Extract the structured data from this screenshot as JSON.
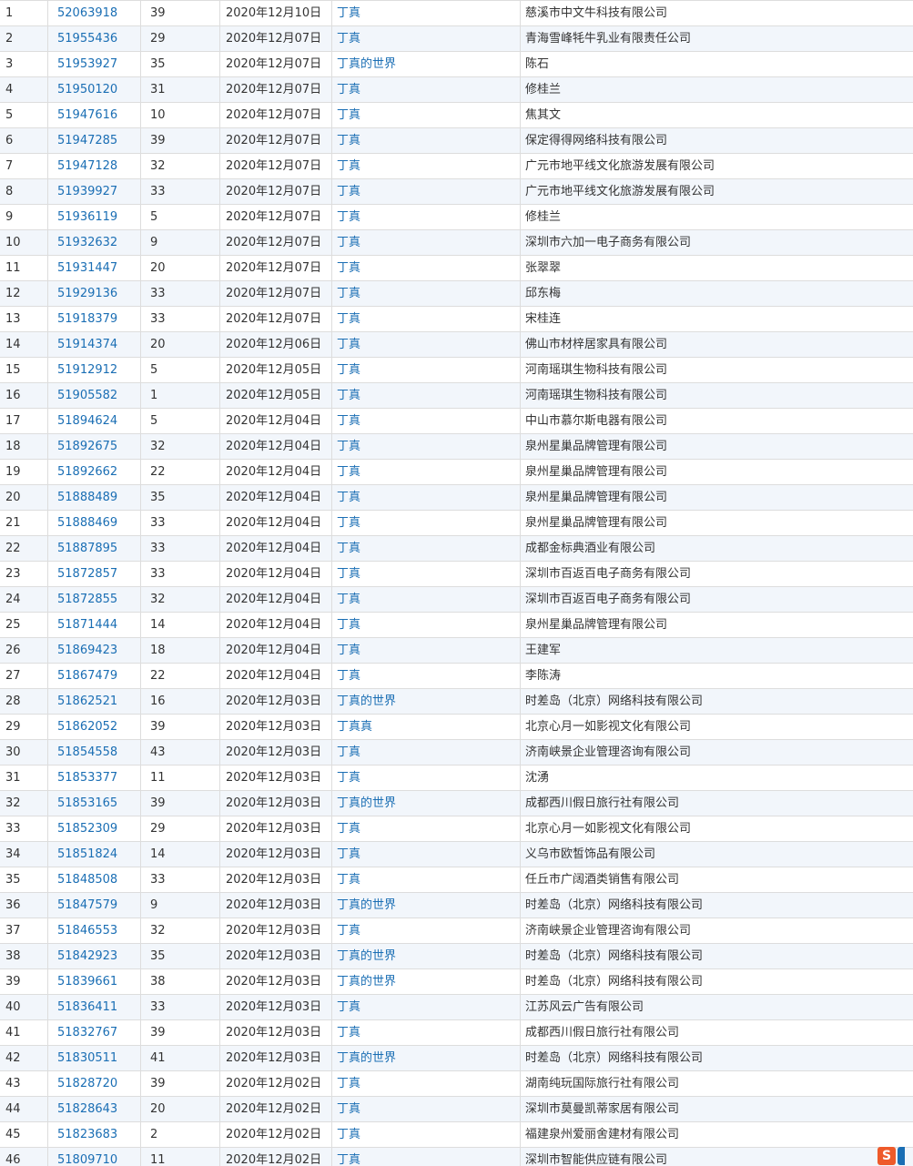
{
  "rows": [
    {
      "idx": "1",
      "reg": "52063918",
      "cls": "39",
      "date": "2020年12月10日",
      "name": "丁真",
      "applicant": "慈溪市中文牛科技有限公司"
    },
    {
      "idx": "2",
      "reg": "51955436",
      "cls": "29",
      "date": "2020年12月07日",
      "name": "丁真",
      "applicant": "青海雪峰牦牛乳业有限责任公司"
    },
    {
      "idx": "3",
      "reg": "51953927",
      "cls": "35",
      "date": "2020年12月07日",
      "name": "丁真的世界",
      "applicant": "陈石"
    },
    {
      "idx": "4",
      "reg": "51950120",
      "cls": "31",
      "date": "2020年12月07日",
      "name": "丁真",
      "applicant": "修桂兰"
    },
    {
      "idx": "5",
      "reg": "51947616",
      "cls": "10",
      "date": "2020年12月07日",
      "name": "丁真",
      "applicant": "焦其文"
    },
    {
      "idx": "6",
      "reg": "51947285",
      "cls": "39",
      "date": "2020年12月07日",
      "name": "丁真",
      "applicant": "保定得得网络科技有限公司"
    },
    {
      "idx": "7",
      "reg": "51947128",
      "cls": "32",
      "date": "2020年12月07日",
      "name": "丁真",
      "applicant": "广元市地平线文化旅游发展有限公司"
    },
    {
      "idx": "8",
      "reg": "51939927",
      "cls": "33",
      "date": "2020年12月07日",
      "name": "丁真",
      "applicant": "广元市地平线文化旅游发展有限公司"
    },
    {
      "idx": "9",
      "reg": "51936119",
      "cls": "5",
      "date": "2020年12月07日",
      "name": "丁真",
      "applicant": "修桂兰"
    },
    {
      "idx": "10",
      "reg": "51932632",
      "cls": "9",
      "date": "2020年12月07日",
      "name": "丁真",
      "applicant": "深圳市六加一电子商务有限公司"
    },
    {
      "idx": "11",
      "reg": "51931447",
      "cls": "20",
      "date": "2020年12月07日",
      "name": "丁真",
      "applicant": "张翠翠"
    },
    {
      "idx": "12",
      "reg": "51929136",
      "cls": "33",
      "date": "2020年12月07日",
      "name": "丁真",
      "applicant": "邱东梅"
    },
    {
      "idx": "13",
      "reg": "51918379",
      "cls": "33",
      "date": "2020年12月07日",
      "name": "丁真",
      "applicant": "宋桂连"
    },
    {
      "idx": "14",
      "reg": "51914374",
      "cls": "20",
      "date": "2020年12月06日",
      "name": "丁真",
      "applicant": "佛山市材梓居家具有限公司"
    },
    {
      "idx": "15",
      "reg": "51912912",
      "cls": "5",
      "date": "2020年12月05日",
      "name": "丁真",
      "applicant": "河南瑶琪生物科技有限公司"
    },
    {
      "idx": "16",
      "reg": "51905582",
      "cls": "1",
      "date": "2020年12月05日",
      "name": "丁真",
      "applicant": "河南瑶琪生物科技有限公司"
    },
    {
      "idx": "17",
      "reg": "51894624",
      "cls": "5",
      "date": "2020年12月04日",
      "name": "丁真",
      "applicant": "中山市慕尔斯电器有限公司"
    },
    {
      "idx": "18",
      "reg": "51892675",
      "cls": "32",
      "date": "2020年12月04日",
      "name": "丁真",
      "applicant": "泉州星巢品牌管理有限公司"
    },
    {
      "idx": "19",
      "reg": "51892662",
      "cls": "22",
      "date": "2020年12月04日",
      "name": "丁真",
      "applicant": "泉州星巢品牌管理有限公司"
    },
    {
      "idx": "20",
      "reg": "51888489",
      "cls": "35",
      "date": "2020年12月04日",
      "name": "丁真",
      "applicant": "泉州星巢品牌管理有限公司"
    },
    {
      "idx": "21",
      "reg": "51888469",
      "cls": "33",
      "date": "2020年12月04日",
      "name": "丁真",
      "applicant": "泉州星巢品牌管理有限公司"
    },
    {
      "idx": "22",
      "reg": "51887895",
      "cls": "33",
      "date": "2020年12月04日",
      "name": "丁真",
      "applicant": "成都金标典酒业有限公司"
    },
    {
      "idx": "23",
      "reg": "51872857",
      "cls": "33",
      "date": "2020年12月04日",
      "name": "丁真",
      "applicant": "深圳市百返百电子商务有限公司"
    },
    {
      "idx": "24",
      "reg": "51872855",
      "cls": "32",
      "date": "2020年12月04日",
      "name": "丁真",
      "applicant": "深圳市百返百电子商务有限公司"
    },
    {
      "idx": "25",
      "reg": "51871444",
      "cls": "14",
      "date": "2020年12月04日",
      "name": "丁真",
      "applicant": "泉州星巢品牌管理有限公司"
    },
    {
      "idx": "26",
      "reg": "51869423",
      "cls": "18",
      "date": "2020年12月04日",
      "name": "丁真",
      "applicant": "王建军"
    },
    {
      "idx": "27",
      "reg": "51867479",
      "cls": "22",
      "date": "2020年12月04日",
      "name": "丁真",
      "applicant": "李陈涛"
    },
    {
      "idx": "28",
      "reg": "51862521",
      "cls": "16",
      "date": "2020年12月03日",
      "name": "丁真的世界",
      "applicant": "时差岛（北京）网络科技有限公司"
    },
    {
      "idx": "29",
      "reg": "51862052",
      "cls": "39",
      "date": "2020年12月03日",
      "name": "丁真真",
      "applicant": "北京心月一如影视文化有限公司"
    },
    {
      "idx": "30",
      "reg": "51854558",
      "cls": "43",
      "date": "2020年12月03日",
      "name": "丁真",
      "applicant": "济南峡景企业管理咨询有限公司"
    },
    {
      "idx": "31",
      "reg": "51853377",
      "cls": "11",
      "date": "2020年12月03日",
      "name": "丁真",
      "applicant": "沈湧"
    },
    {
      "idx": "32",
      "reg": "51853165",
      "cls": "39",
      "date": "2020年12月03日",
      "name": "丁真的世界",
      "applicant": "成都西川假日旅行社有限公司"
    },
    {
      "idx": "33",
      "reg": "51852309",
      "cls": "29",
      "date": "2020年12月03日",
      "name": "丁真",
      "applicant": "北京心月一如影视文化有限公司"
    },
    {
      "idx": "34",
      "reg": "51851824",
      "cls": "14",
      "date": "2020年12月03日",
      "name": "丁真",
      "applicant": "义乌市欧皙饰品有限公司"
    },
    {
      "idx": "35",
      "reg": "51848508",
      "cls": "33",
      "date": "2020年12月03日",
      "name": "丁真",
      "applicant": "任丘市广阔酒类销售有限公司"
    },
    {
      "idx": "36",
      "reg": "51847579",
      "cls": "9",
      "date": "2020年12月03日",
      "name": "丁真的世界",
      "applicant": "时差岛（北京）网络科技有限公司"
    },
    {
      "idx": "37",
      "reg": "51846553",
      "cls": "32",
      "date": "2020年12月03日",
      "name": "丁真",
      "applicant": "济南峡景企业管理咨询有限公司"
    },
    {
      "idx": "38",
      "reg": "51842923",
      "cls": "35",
      "date": "2020年12月03日",
      "name": "丁真的世界",
      "applicant": "时差岛（北京）网络科技有限公司"
    },
    {
      "idx": "39",
      "reg": "51839661",
      "cls": "38",
      "date": "2020年12月03日",
      "name": "丁真的世界",
      "applicant": "时差岛（北京）网络科技有限公司"
    },
    {
      "idx": "40",
      "reg": "51836411",
      "cls": "33",
      "date": "2020年12月03日",
      "name": "丁真",
      "applicant": "江苏风云广告有限公司"
    },
    {
      "idx": "41",
      "reg": "51832767",
      "cls": "39",
      "date": "2020年12月03日",
      "name": "丁真",
      "applicant": "成都西川假日旅行社有限公司"
    },
    {
      "idx": "42",
      "reg": "51830511",
      "cls": "41",
      "date": "2020年12月03日",
      "name": "丁真的世界",
      "applicant": "时差岛（北京）网络科技有限公司"
    },
    {
      "idx": "43",
      "reg": "51828720",
      "cls": "39",
      "date": "2020年12月02日",
      "name": "丁真",
      "applicant": "湖南纯玩国际旅行社有限公司"
    },
    {
      "idx": "44",
      "reg": "51828643",
      "cls": "20",
      "date": "2020年12月02日",
      "name": "丁真",
      "applicant": "深圳市莫曼凯蒂家居有限公司"
    },
    {
      "idx": "45",
      "reg": "51823683",
      "cls": "2",
      "date": "2020年12月02日",
      "name": "丁真",
      "applicant": "福建泉州爱丽舍建材有限公司"
    },
    {
      "idx": "46",
      "reg": "51809710",
      "cls": "11",
      "date": "2020年12月02日",
      "name": "丁真",
      "applicant": "深圳市智能供应链有限公司"
    }
  ],
  "badge": {
    "letter": "S",
    "icon": "sogou-input-icon"
  },
  "colors": {
    "link": "#1a6eb4",
    "text": "#333333",
    "row_alt": "#f2f6fb",
    "border": "#dddddd",
    "badge": "#ee5a2a"
  }
}
